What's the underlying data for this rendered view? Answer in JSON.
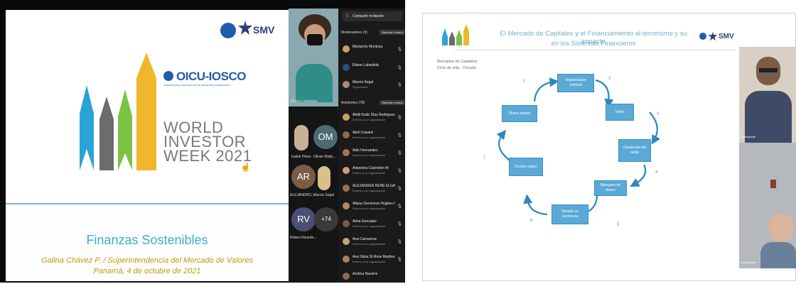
{
  "left_screen": {
    "slide": {
      "iosco_brand": "OICU-IOSCO",
      "iosco_tagline": "INTERNATIONAL ORGANIZATION OF SECURITIES COMMISSIONS",
      "smv_brand": "SMV",
      "event_lines": [
        "WORLD",
        "INVESTOR",
        "WEEK 2021"
      ],
      "topic": "Finanzas Sostenibles",
      "author": "Galina Chávez P. / Superintendencia del Mercado de Valores",
      "place_date": "Panamá, 4 de octubre de 2021"
    },
    "video_tiles": [
      {
        "name": "Eliane Labastida"
      },
      {
        "name": "Isabel Pérez",
        "initials": ""
      },
      {
        "name": "Olivier Maltz...",
        "initials": "OM"
      },
      {
        "name": "ALEJANDRO...",
        "initials": "AR"
      },
      {
        "name": "Marcia Segal",
        "initials": ""
      },
      {
        "name": "Ruben Ricardo...",
        "initials": "RV"
      },
      {
        "name": "",
        "initials": "+74"
      }
    ],
    "panel": {
      "share_label": "Compartir invitación",
      "moderators_header": "Moderadores (3)",
      "moderators_button": "Silenciar a todos",
      "moderators": [
        {
          "name": "Mariannis Montoya",
          "role": ""
        },
        {
          "name": "Eliane Labastida",
          "role": ""
        },
        {
          "name": "Marcia Segal",
          "role": "Organizador"
        }
      ],
      "attendees_header": "Asistentes (78)",
      "attendees_button": "Silenciar a todos",
      "attendees": [
        {
          "name": "Abdil Kadir Diaz Rodriguez",
          "sub": "Externo a su organización"
        },
        {
          "name": "Abril Coward",
          "sub": "Externo a su organización"
        },
        {
          "name": "Adis Hernandez",
          "sub": "Externo a su organización"
        },
        {
          "name": "Alejandra Castrellon M",
          "sub": "Externo a su organización"
        },
        {
          "name": "ALEXANDER RENE ELGAAA R...",
          "sub": "Externo a su organización"
        },
        {
          "name": "Allana Genoveva Hughes Pinzy",
          "sub": "Externo a su organización"
        },
        {
          "name": "Alma Gonzalez",
          "sub": "Externo a su organización"
        },
        {
          "name": "Ana Camarena",
          "sub": "Externo a su organización"
        },
        {
          "name": "Ana Silvia St Rose Medina",
          "sub": "Externo a su organización"
        },
        {
          "name": "Andrea Navarro",
          "sub": ""
        }
      ]
    }
  },
  "right_screen": {
    "header_title_line1": "El Mercado de Capitales y el Financiamiento al terrorismo y su impacto",
    "header_title_line2": "en los Sistemas Financieros",
    "smv_brand": "SMV",
    "subtitle_line1": "Mercados de Capitales",
    "subtitle_line2": "Ciclo de vida - Circular",
    "cycle_nodes": [
      {
        "label": "Organización criminal",
        "num": "1"
      },
      {
        "label": "Delito",
        "num": "2"
      },
      {
        "label": "Ganancias del delito",
        "num": "3"
      },
      {
        "label": "Blanqueo de dinero",
        "num": "4"
      },
      {
        "label": "Simular su existencia",
        "num": "5"
      },
      {
        "label": "Ocultar origen",
        "num": "6"
      },
      {
        "label": "Dinero lavado",
        "num": "7"
      }
    ],
    "camera_labels": [
      "Participante",
      "Participante"
    ]
  },
  "colors": {
    "accent_teal": "#3bb0d0",
    "gold": "#c39a10",
    "cycle_blue": "#5aa9d6"
  }
}
